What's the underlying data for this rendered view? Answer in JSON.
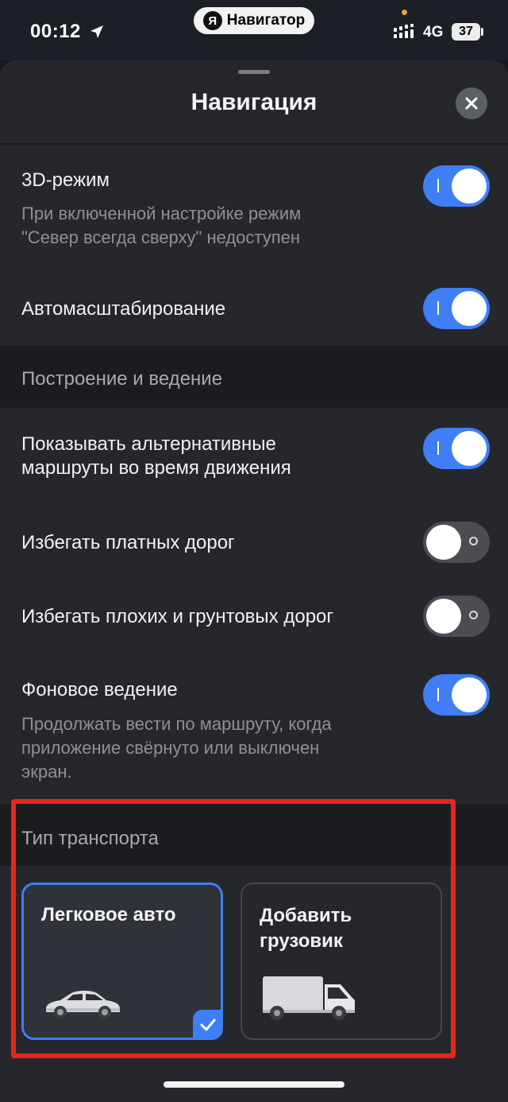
{
  "status_bar": {
    "time": "00:12",
    "app_name": "Навигатор",
    "app_logo": "Я",
    "network": "4G",
    "battery": "37"
  },
  "sheet": {
    "title": "Навигация"
  },
  "settings": {
    "mode_3d": {
      "title": "3D-режим",
      "subtitle_line1": "При включенной настройке режим",
      "subtitle_line2": "\"Север всегда сверху\" недоступен",
      "enabled": true
    },
    "auto_zoom": {
      "title": "Автомасштабирование",
      "enabled": true
    }
  },
  "section_routing": {
    "label": "Построение и ведение",
    "alt_routes": {
      "title_line1": "Показывать альтернативные",
      "title_line2": "маршруты во время движения",
      "enabled": true
    },
    "avoid_toll": {
      "title": "Избегать платных дорог",
      "enabled": false
    },
    "avoid_bad": {
      "title": "Избегать плохих и грунтовых дорог",
      "enabled": false
    },
    "background": {
      "title": "Фоновое ведение",
      "subtitle_line1": "Продолжать вести по маршруту, когда",
      "subtitle_line2": "приложение свёрнуто или выключен",
      "subtitle_line3": "экран.",
      "enabled": true
    }
  },
  "section_transport": {
    "label": "Тип транспорта",
    "car": {
      "label": "Легковое авто",
      "selected": true
    },
    "truck": {
      "label_line1": "Добавить",
      "label_line2": "грузовик",
      "selected": false
    }
  },
  "colors": {
    "accent": "#3f7ef5",
    "sheet_bg": "#26272c",
    "highlight": "#e4261e"
  }
}
